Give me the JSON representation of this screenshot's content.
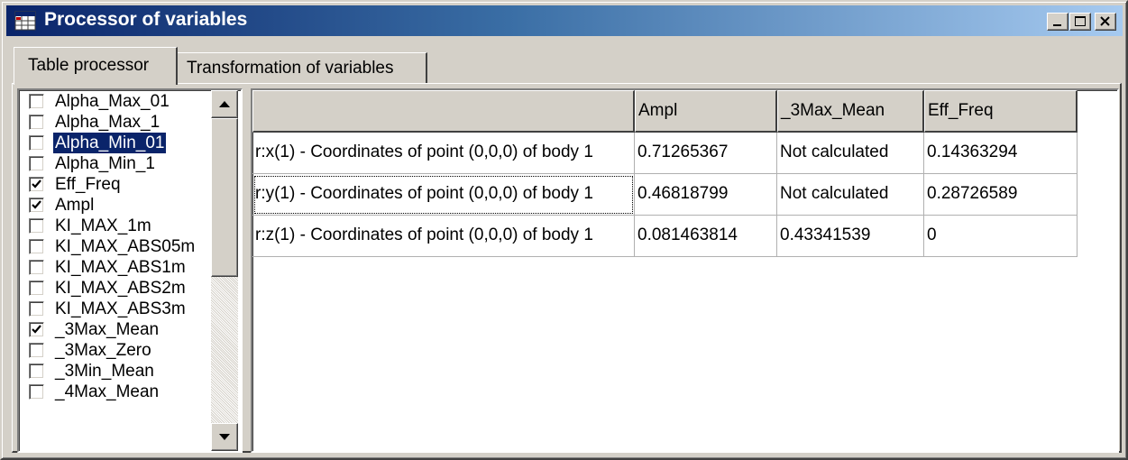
{
  "window": {
    "title": "Processor of variables",
    "icon": "grid-table-icon",
    "controls": {
      "minimize": "minimize-icon",
      "maximize": "maximize-icon",
      "close": "close-icon"
    }
  },
  "tabs": [
    {
      "label": "Table processor",
      "active": true
    },
    {
      "label": "Transformation of variables",
      "active": false
    }
  ],
  "variables": [
    {
      "label": "Alpha_Max_01",
      "checked": false,
      "selected": false
    },
    {
      "label": "Alpha_Max_1",
      "checked": false,
      "selected": false
    },
    {
      "label": "Alpha_Min_01",
      "checked": false,
      "selected": true
    },
    {
      "label": "Alpha_Min_1",
      "checked": false,
      "selected": false
    },
    {
      "label": "Eff_Freq",
      "checked": true,
      "selected": false
    },
    {
      "label": "Ampl",
      "checked": true,
      "selected": false
    },
    {
      "label": "KI_MAX_1m",
      "checked": false,
      "selected": false
    },
    {
      "label": "KI_MAX_ABS05m",
      "checked": false,
      "selected": false
    },
    {
      "label": "KI_MAX_ABS1m",
      "checked": false,
      "selected": false
    },
    {
      "label": "KI_MAX_ABS2m",
      "checked": false,
      "selected": false
    },
    {
      "label": "KI_MAX_ABS3m",
      "checked": false,
      "selected": false
    },
    {
      "label": "_3Max_Mean",
      "checked": true,
      "selected": false
    },
    {
      "label": "_3Max_Zero",
      "checked": false,
      "selected": false
    },
    {
      "label": "_3Min_Mean",
      "checked": false,
      "selected": false
    },
    {
      "label": "_4Max_Mean",
      "checked": false,
      "selected": false
    }
  ],
  "table": {
    "columns": [
      "",
      "Ampl",
      "_3Max_Mean",
      "Eff_Freq"
    ],
    "rows": [
      [
        "r:x(1) - Coordinates of point (0,0,0) of body 1",
        "0.71265367",
        "Not calculated",
        "0.14363294"
      ],
      [
        "r:y(1) - Coordinates of point (0,0,0) of body 1",
        "0.46818799",
        "Not calculated",
        "0.28726589"
      ],
      [
        "r:z(1) - Coordinates of point (0,0,0) of body 1",
        "0.081463814",
        "0.43341539",
        "0"
      ]
    ]
  },
  "colors": {
    "title_start": "#0a246a",
    "title_end": "#a6caf0",
    "selection": "#0a246a",
    "face": "#d4d0c8"
  }
}
